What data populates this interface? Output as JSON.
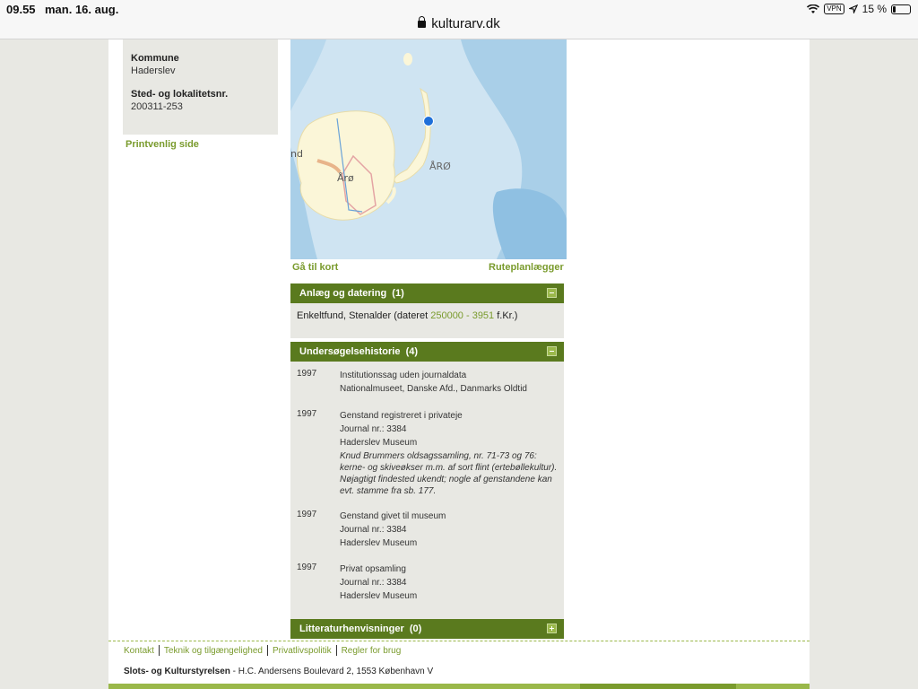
{
  "status_bar": {
    "time": "09.55",
    "date": "man. 16. aug.",
    "vpn": "VPN",
    "battery": "15 %",
    "battery_level": 0.15
  },
  "address_bar": {
    "url": "kulturarv.dk"
  },
  "info_box": {
    "kommune_label": "Kommune",
    "kommune_value": "Haderslev",
    "sted_label": "Sted- og lokalitetsnr.",
    "sted_value": "200311-253"
  },
  "print_link": "Printvenlig side",
  "map": {
    "labels": [
      "nd",
      "Årø",
      "ÅRØ"
    ],
    "goto_map": "Gå til kort",
    "route_planner": "Ruteplanlægger"
  },
  "section_dating": {
    "title": "Anlæg og datering",
    "count": "(1)",
    "text_before": "Enkeltfund, Stenalder (dateret ",
    "date_range": "250000 - 3951",
    "text_after": " f.Kr.)"
  },
  "section_history": {
    "title": "Undersøgelsehistorie",
    "count": "(4)",
    "entries": [
      {
        "year": "1997",
        "lines": [
          "Institutionssag uden journaldata",
          "Nationalmuseet, Danske Afd., Danmarks Oldtid"
        ],
        "note": ""
      },
      {
        "year": "1997",
        "lines": [
          "Genstand registreret i privateje",
          "Journal nr.: 3384",
          "Haderslev Museum"
        ],
        "note": "Knud Brummers oldsagssamling, nr. 71-73 og 76: kerne- og skiveøkser m.m. af sort flint (ertebøllekultur). Nøjagtigt findested ukendt; nogle af genstandene kan evt. stamme fra sb. 177."
      },
      {
        "year": "1997",
        "lines": [
          "Genstand givet til museum",
          "Journal nr.: 3384",
          "Haderslev Museum"
        ],
        "note": ""
      },
      {
        "year": "1997",
        "lines": [
          "Privat opsamling",
          "Journal nr.: 3384",
          "Haderslev Museum"
        ],
        "note": ""
      }
    ]
  },
  "section_literature": {
    "title": "Litteraturhenvisninger",
    "count": "(0)"
  },
  "footer": {
    "links": [
      "Kontakt",
      "Teknik og tilgængelighed",
      "Privatlivspolitik",
      "Regler for brug"
    ],
    "org": "Slots- og Kulturstyrelsen",
    "address": " - H.C. Andersens Boulevard 2, 1553 København V"
  }
}
